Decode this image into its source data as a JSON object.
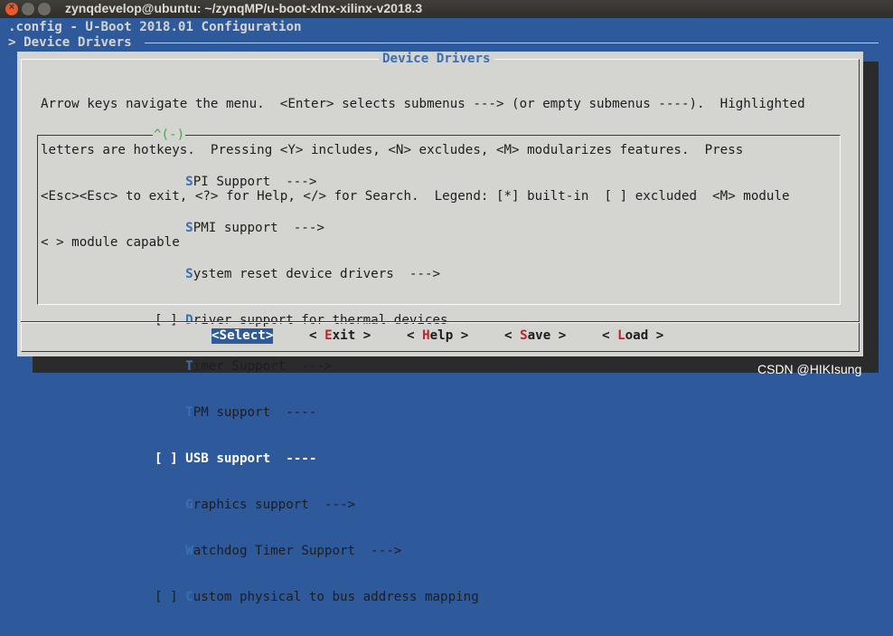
{
  "window": {
    "title": "zynqdevelop@ubuntu: ~/zynqMP/u-boot-xlnx-xilinx-v2018.3",
    "close_glyph": "×"
  },
  "header": {
    "config_title": ".config - U-Boot 2018.01 Configuration",
    "breadcrumb": "> Device Drivers"
  },
  "dialog": {
    "title": "Device Drivers",
    "help_lines": [
      "Arrow keys navigate the menu.  <Enter> selects submenus ---> (or empty submenus ----).  Highlighted",
      "letters are hotkeys.  Pressing <Y> includes, <N> excludes, <M> modularizes features.  Press",
      "<Esc><Esc> to exit, <?> for Help, </> for Search.  Legend: [*] built-in  [ ] excluded  <M> module",
      "< > module capable"
    ],
    "scroll_indicator": "^(-)",
    "menu_items": [
      {
        "prefix": "    ",
        "hotkey": "S",
        "rest": "PI Support  --->"
      },
      {
        "prefix": "    ",
        "hotkey": "S",
        "rest": "PMI support  --->"
      },
      {
        "prefix": "    ",
        "hotkey": "S",
        "rest": "ystem reset device drivers  --->"
      },
      {
        "prefix": "[ ] ",
        "hotkey": "D",
        "rest": "river support for thermal devices"
      },
      {
        "prefix": "    ",
        "hotkey": "T",
        "rest": "imer Support  --->"
      },
      {
        "prefix": "    ",
        "hotkey": "T",
        "rest": "PM support  ----"
      },
      {
        "prefix": "[ ] ",
        "hotkey": "U",
        "rest": "SB support  ----",
        "selected": true
      },
      {
        "prefix": "    ",
        "hotkey": "G",
        "rest": "raphics support  --->"
      },
      {
        "prefix": "    ",
        "hotkey": "W",
        "rest": "atchdog Timer Support  --->"
      },
      {
        "prefix": "[ ] ",
        "hotkey": "C",
        "rest": "ustom physical to bus address mapping"
      }
    ],
    "buttons": {
      "select": {
        "open": "<",
        "hotkey": "S",
        "rest": "elect",
        "close": ">"
      },
      "exit": {
        "open": "< ",
        "hotkey": "E",
        "rest": "xit",
        "close": " >"
      },
      "help": {
        "open": "< ",
        "hotkey": "H",
        "rest": "elp",
        "close": " >"
      },
      "save": {
        "open": "< ",
        "hotkey": "S",
        "rest": "ave",
        "close": " >"
      },
      "load": {
        "open": "< ",
        "hotkey": "L",
        "rest": "oad",
        "close": " >"
      }
    }
  },
  "watermark": "CSDN @HIKIsung",
  "colors": {
    "terminal_bg": "#2e5a9c",
    "dialog_bg": "#d4d4d0",
    "hotkey": "#3a6fb2",
    "button_hotkey": "#b7262a",
    "scroll_indicator": "#4aa54a"
  }
}
